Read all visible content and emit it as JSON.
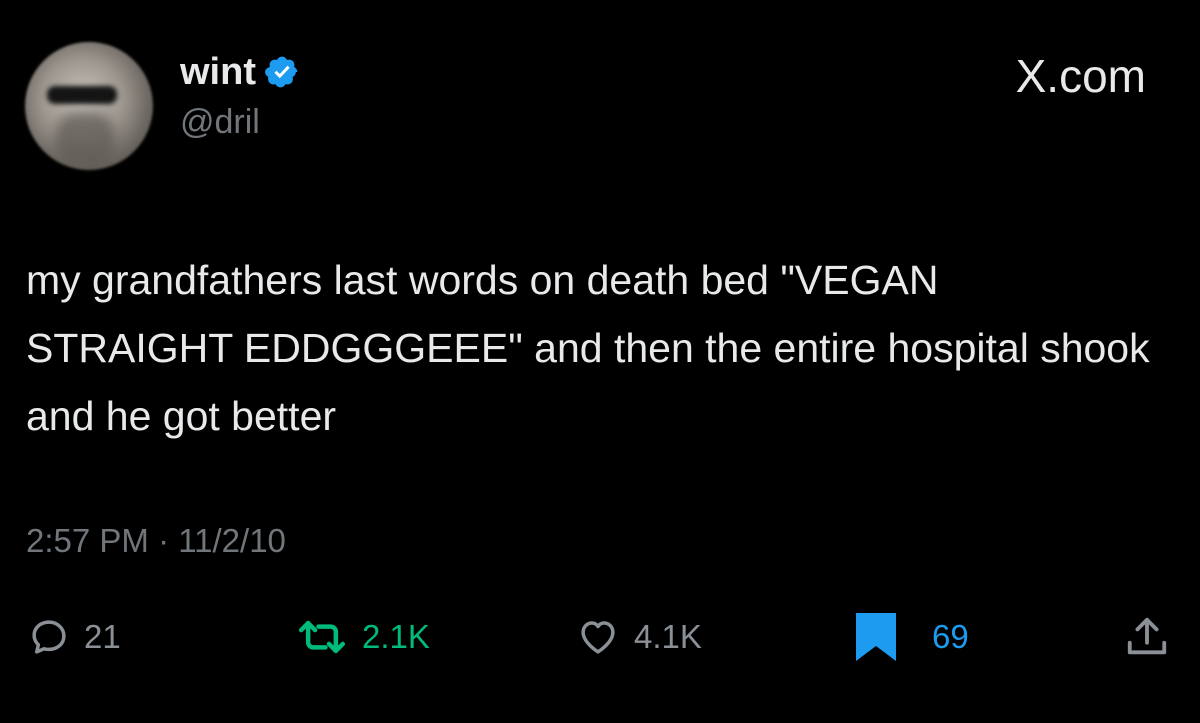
{
  "author": {
    "display_name": "wint",
    "handle": "@dril",
    "verified": true
  },
  "brand": {
    "label": "X.com"
  },
  "tweet": {
    "text": "my grandfathers last words on death bed \"VEGAN STRAIGHT EDDGGGEEE\" and then the entire hospital shook and he got better",
    "time": "2:57 PM",
    "separator": "·",
    "date": "11/2/10"
  },
  "actions": {
    "replies": "21",
    "reposts": "2.1K",
    "likes": "4.1K",
    "bookmarks": "69"
  },
  "colors": {
    "background": "#000000",
    "text": "#e7e9ea",
    "muted": "#71767b",
    "repost_active": "#00ba7c",
    "bookmark_active": "#1d9bf0",
    "verified_badge": "#1d9bf0"
  },
  "icons": {
    "reply": "reply-icon",
    "repost": "repost-icon",
    "like": "heart-icon",
    "bookmark": "bookmark-icon",
    "share": "share-icon",
    "verified": "verified-badge-icon"
  }
}
